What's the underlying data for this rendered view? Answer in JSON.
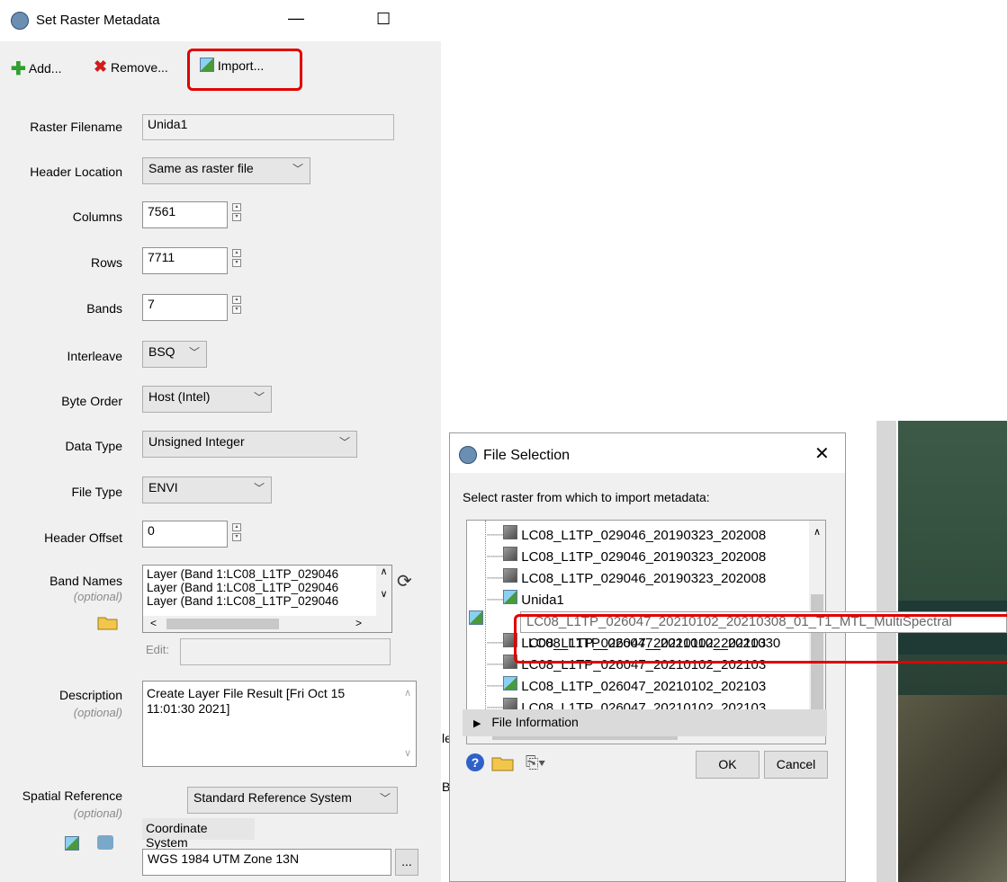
{
  "main": {
    "title": "Set Raster Metadata",
    "window_buttons": {
      "minimize": "—",
      "maximize": "☐"
    },
    "toolbar": {
      "add": "Add...",
      "remove": "Remove...",
      "import": "Import..."
    },
    "fields": {
      "raster_filename": {
        "label": "Raster Filename",
        "value": "Unida1"
      },
      "header_location": {
        "label": "Header Location",
        "value": "Same as raster file"
      },
      "columns": {
        "label": "Columns",
        "value": "7561"
      },
      "rows": {
        "label": "Rows",
        "value": "7711"
      },
      "bands": {
        "label": "Bands",
        "value": "7"
      },
      "interleave": {
        "label": "Interleave",
        "value": "BSQ"
      },
      "byte_order": {
        "label": "Byte Order",
        "value": "Host (Intel)"
      },
      "data_type": {
        "label": "Data Type",
        "value": "Unsigned Integer"
      },
      "file_type": {
        "label": "File Type",
        "value": "ENVI"
      },
      "header_offset": {
        "label": "Header Offset",
        "value": "0"
      },
      "band_names": {
        "label": "Band Names",
        "optional": "(optional)",
        "items": [
          "Layer (Band 1:LC08_L1TP_029046",
          "Layer (Band 1:LC08_L1TP_029046",
          "Layer (Band 1:LC08_L1TP_029046"
        ],
        "edit_label": "Edit:"
      },
      "description": {
        "label": "Description",
        "optional": "(optional)",
        "line1": "Create Layer File Result [Fri Oct 15",
        "line2": "11:01:30 2021]"
      },
      "spatial_reference": {
        "label": "Spatial Reference",
        "optional": "(optional)",
        "system": "Standard Reference System",
        "coord_header": "Coordinate System",
        "coord_value": "WGS 1984 UTM Zone 13N",
        "browse": "..."
      }
    }
  },
  "file_selection": {
    "title": "File Selection",
    "prompt": "Select raster from which to import metadata:",
    "items": [
      {
        "name": "LC08_L1TP_029046_20190323_202008",
        "icon": "raster-icon"
      },
      {
        "name": "LC08_L1TP_029046_20190323_202008",
        "icon": "raster-icon"
      },
      {
        "name": "LC08_L1TP_029046_20190323_202008",
        "icon": "raster-icon"
      },
      {
        "name": "Unida1",
        "icon": "image-icon"
      },
      {
        "name": "LC08_L1TP_026047_20210102_2021030",
        "icon": "image-icon"
      },
      {
        "name": "LC08_L1TP_026047_20210102_202103",
        "icon": "raster-icon"
      },
      {
        "name": "LC08_L1TP_026047_20210102_202103",
        "icon": "raster-icon"
      },
      {
        "name": "LC08_L1TP_026047_20210102_202103",
        "icon": "image-icon"
      },
      {
        "name": "LC08_L1TP_026047_20210102_202103",
        "icon": "raster-icon"
      }
    ],
    "tooltip": "LC08_L1TP_026047_20210102_20210308_01_T1_MTL_MultiSpectral",
    "file_information": "File Information",
    "ok": "OK",
    "cancel": "Cancel"
  },
  "colors": {
    "highlight": "#e00000",
    "dialog_bg": "#f0f0f0"
  }
}
